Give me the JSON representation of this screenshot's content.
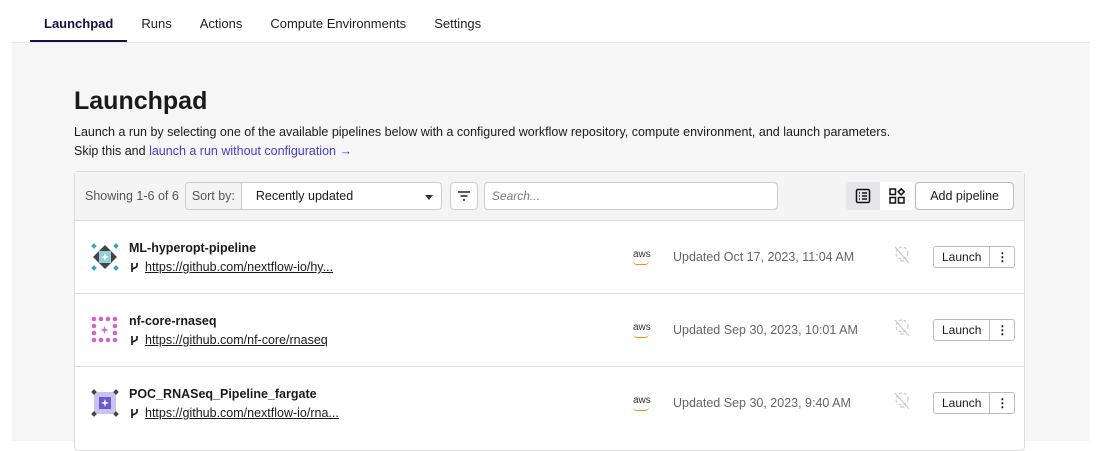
{
  "tabs": [
    {
      "label": "Launchpad"
    },
    {
      "label": "Runs"
    },
    {
      "label": "Actions"
    },
    {
      "label": "Compute Environments"
    },
    {
      "label": "Settings"
    }
  ],
  "page": {
    "title": "Launchpad",
    "description": "Launch a run by selecting one of the available pipelines below with a configured workflow repository, compute environment, and launch parameters.",
    "skip_prefix": "Skip this and",
    "skip_link": "launch a run without configuration →"
  },
  "toolbar": {
    "showing": "Showing 1-6 of 6",
    "sort_label": "Sort by:",
    "sort_value": "Recently updated",
    "search_placeholder": "Search...",
    "add_label": "Add pipeline"
  },
  "colors": {
    "accent": "#160f41",
    "link": "#4a3bd1",
    "aws": "#f29100"
  },
  "pipelines": [
    {
      "name": "ML-hyperopt-pipeline",
      "url": "https://github.com/nextflow-io/hy...",
      "provider": "aws",
      "updated": "Updated Oct 17, 2023, 11:04 AM",
      "launch": "Launch",
      "icon": "teal-diamond-logo"
    },
    {
      "name": "nf-core-rnaseq",
      "url": "https://github.com/nf-core/rnaseq",
      "provider": "aws",
      "updated": "Updated Sep 30, 2023, 10:01 AM",
      "launch": "Launch",
      "icon": "pink-dots-logo"
    },
    {
      "name": "POC_RNASeq_Pipeline_fargate",
      "url": "https://github.com/nextflow-io/rna...",
      "provider": "aws",
      "updated": "Updated Sep 30, 2023, 9:40 AM",
      "launch": "Launch",
      "icon": "purple-square-logo"
    }
  ]
}
